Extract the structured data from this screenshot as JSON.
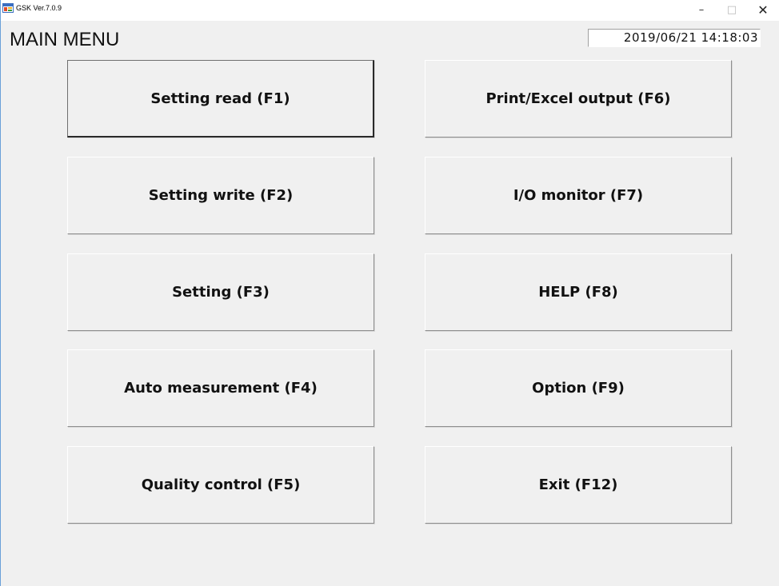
{
  "window": {
    "title": "GSK Ver.7.0.9",
    "controls": {
      "minimize": "–",
      "maximize": "□",
      "close": "✕"
    },
    "icon": "app-window-icon"
  },
  "header": {
    "title": "MAIN MENU",
    "datetime": "2019/06/21 14:18:03"
  },
  "buttons": {
    "setting_read": "Setting read (F1)",
    "setting_write": "Setting write (F2)",
    "setting": "Setting (F3)",
    "auto_measurement": "Auto measurement (F4)",
    "quality_control": "Quality control (F5)",
    "print_excel_output": "Print/Excel output (F6)",
    "io_monitor": "I/O monitor (F7)",
    "help": "HELP (F8)",
    "option": "Option (F9)",
    "exit": "Exit (F12)"
  },
  "colors": {
    "window_background": "#f0f0f0",
    "titlebar_background": "#ffffff",
    "window_border_accent": "#6aa0d8"
  }
}
